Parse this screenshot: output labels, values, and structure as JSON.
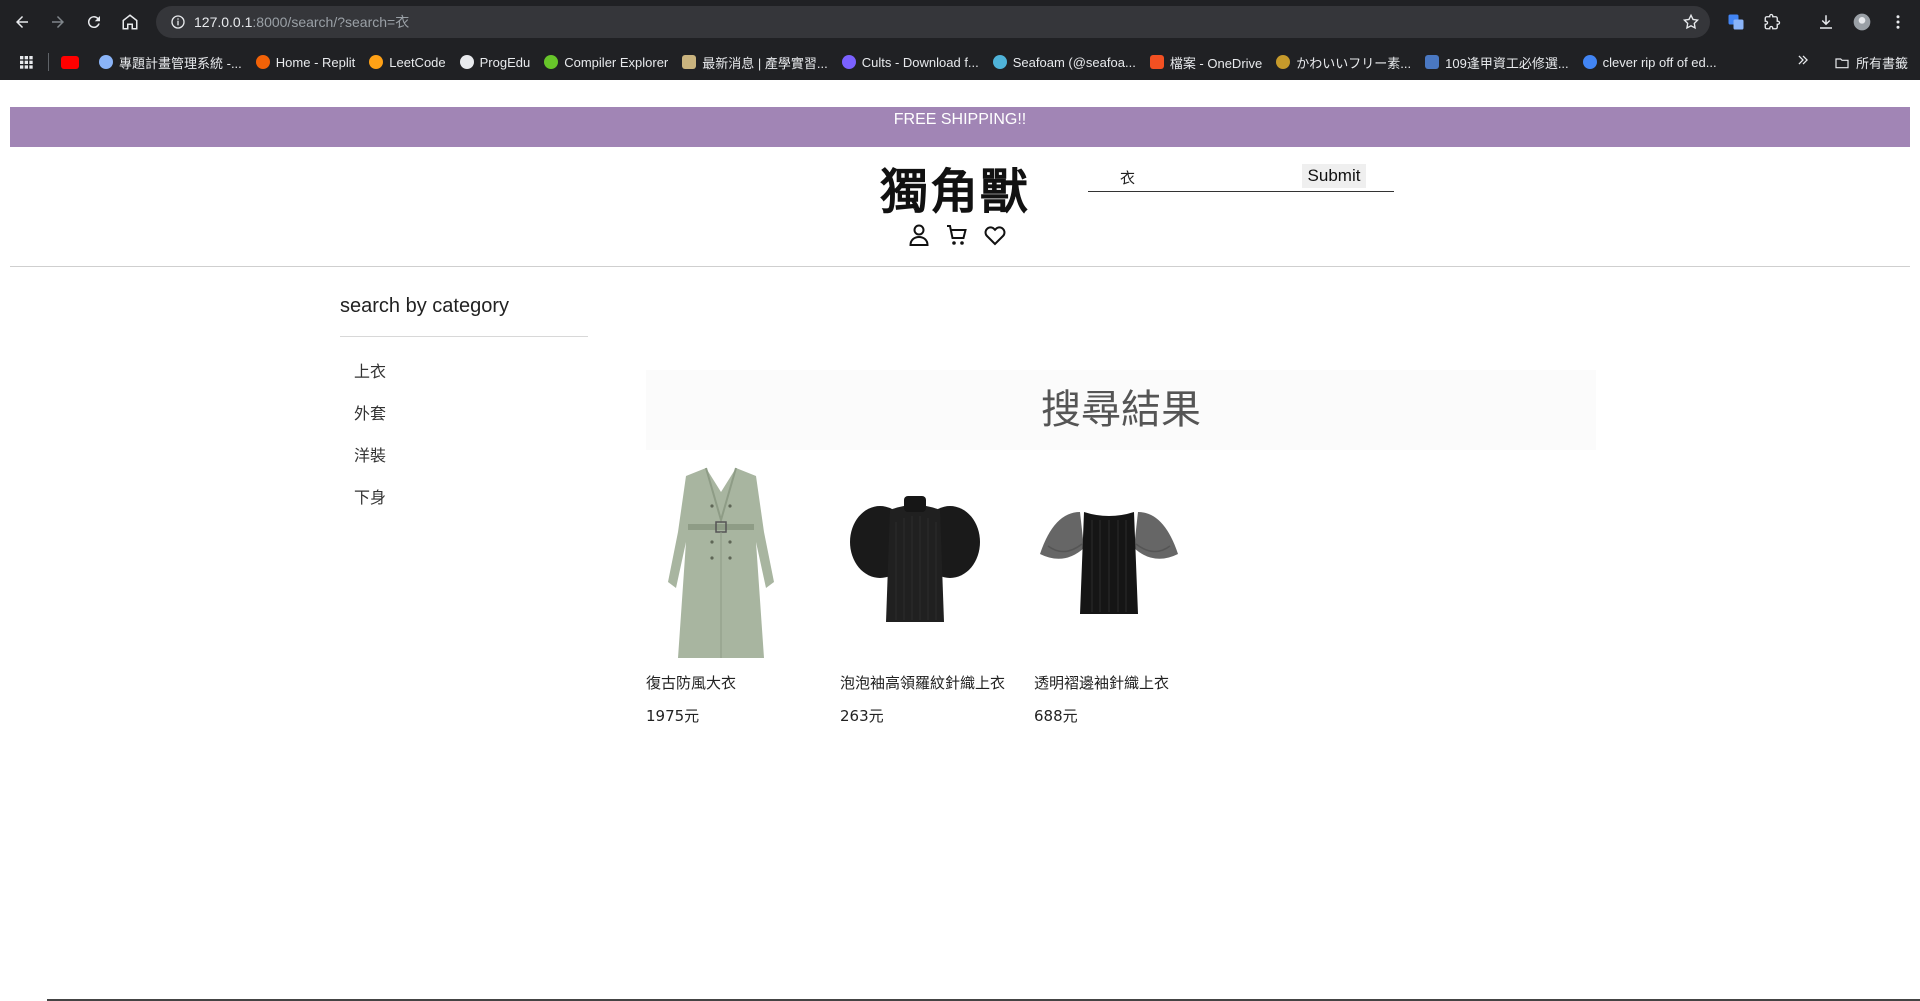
{
  "browser": {
    "url_host": "127.0.0.1",
    "url_rest": ":8000/search/?search=衣",
    "bookmarks": [
      {
        "label": "",
        "icon": "youtube-icon",
        "color": "#ff0000"
      },
      {
        "label": "專題計畫管理系統 -...",
        "icon": "globe-icon",
        "color": "#8ab4f8"
      },
      {
        "label": "Home - Replit",
        "icon": "replit-icon",
        "color": "#f26207"
      },
      {
        "label": "LeetCode",
        "icon": "leetcode-icon",
        "color": "#ffa116"
      },
      {
        "label": "ProgEdu",
        "icon": "progedu-icon",
        "color": "#e8eaed"
      },
      {
        "label": "Compiler Explorer",
        "icon": "compiler-explorer-icon",
        "color": "#67c52a"
      },
      {
        "label": "最新消息 | 產學實習...",
        "icon": "news-icon",
        "color": "#c9b37e"
      },
      {
        "label": "Cults - Download f...",
        "icon": "cults-icon",
        "color": "#7b61ff"
      },
      {
        "label": "Seafoam (@seafoa...",
        "icon": "seafoam-icon",
        "color": "#4fb3d9"
      },
      {
        "label": "檔案 - OneDrive",
        "icon": "microsoft-icon",
        "color": "#f25022"
      },
      {
        "label": "かわいいフリー素...",
        "icon": "irasutoya-icon",
        "color": "#c69a2b"
      },
      {
        "label": "109逢甲資工必修選...",
        "icon": "document-icon",
        "color": "#4a78c2"
      },
      {
        "label": "clever rip off of ed...",
        "icon": "google-icon",
        "color": "#4285f4"
      }
    ],
    "all_bookmarks": "所有書籤"
  },
  "banner": {
    "text": "FREE SHIPPING!!"
  },
  "header": {
    "logo": "獨角獸",
    "search_value": "衣",
    "submit_label": "Submit"
  },
  "sidebar": {
    "title": "search by category",
    "items": [
      "上衣",
      "外套",
      "洋裝",
      "下身"
    ]
  },
  "results": {
    "title": "搜尋結果",
    "products": [
      {
        "name": "復古防風大衣",
        "price": "1975元"
      },
      {
        "name": "泡泡袖高領羅紋針織上衣",
        "price": "263元"
      },
      {
        "name": "透明褶邊袖針織上衣",
        "price": "688元"
      }
    ]
  }
}
